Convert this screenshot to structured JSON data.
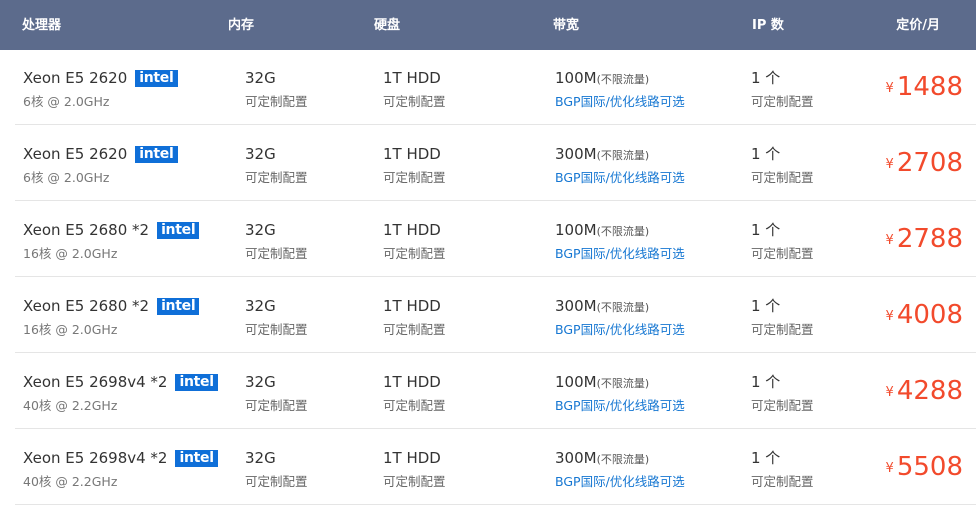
{
  "header": {
    "cpu": "处理器",
    "memory": "内存",
    "disk": "硬盘",
    "bandwidth": "带宽",
    "ip": "IP 数",
    "price": "定价/月"
  },
  "currency_symbol": "¥",
  "brand_badge": "intel",
  "colors": {
    "header_bg": "#5c6b8c",
    "price": "#f24a2c",
    "badge_bg": "#0f6fd8",
    "link_blue": "#1677d2"
  },
  "rows": [
    {
      "cpu_model": "Xeon E5 2620",
      "cpu_spec": "6核 @ 2.0GHz",
      "memory": "32G",
      "memory_note": "可定制配置",
      "disk": "1T HDD",
      "disk_note": "可定制配置",
      "bandwidth": "100M",
      "bandwidth_tag": "(不限流量)",
      "bandwidth_note": "BGP国际/优化线路可选",
      "ip": "1 个",
      "ip_note": "可定制配置",
      "price": "1488"
    },
    {
      "cpu_model": "Xeon E5 2620",
      "cpu_spec": "6核 @ 2.0GHz",
      "memory": "32G",
      "memory_note": "可定制配置",
      "disk": "1T HDD",
      "disk_note": "可定制配置",
      "bandwidth": "300M",
      "bandwidth_tag": "(不限流量)",
      "bandwidth_note": "BGP国际/优化线路可选",
      "ip": "1 个",
      "ip_note": "可定制配置",
      "price": "2708"
    },
    {
      "cpu_model": "Xeon E5 2680 *2",
      "cpu_spec": "16核 @ 2.0GHz",
      "memory": "32G",
      "memory_note": "可定制配置",
      "disk": "1T HDD",
      "disk_note": "可定制配置",
      "bandwidth": "100M",
      "bandwidth_tag": "(不限流量)",
      "bandwidth_note": "BGP国际/优化线路可选",
      "ip": "1 个",
      "ip_note": "可定制配置",
      "price": "2788"
    },
    {
      "cpu_model": "Xeon E5 2680 *2",
      "cpu_spec": "16核 @ 2.0GHz",
      "memory": "32G",
      "memory_note": "可定制配置",
      "disk": "1T HDD",
      "disk_note": "可定制配置",
      "bandwidth": "300M",
      "bandwidth_tag": "(不限流量)",
      "bandwidth_note": "BGP国际/优化线路可选",
      "ip": "1 个",
      "ip_note": "可定制配置",
      "price": "4008"
    },
    {
      "cpu_model": "Xeon E5 2698v4 *2",
      "cpu_spec": "40核 @ 2.2GHz",
      "memory": "32G",
      "memory_note": "可定制配置",
      "disk": "1T HDD",
      "disk_note": "可定制配置",
      "bandwidth": "100M",
      "bandwidth_tag": "(不限流量)",
      "bandwidth_note": "BGP国际/优化线路可选",
      "ip": "1 个",
      "ip_note": "可定制配置",
      "price": "4288"
    },
    {
      "cpu_model": "Xeon E5 2698v4 *2",
      "cpu_spec": "40核 @ 2.2GHz",
      "memory": "32G",
      "memory_note": "可定制配置",
      "disk": "1T HDD",
      "disk_note": "可定制配置",
      "bandwidth": "300M",
      "bandwidth_tag": "(不限流量)",
      "bandwidth_note": "BGP国际/优化线路可选",
      "ip": "1 个",
      "ip_note": "可定制配置",
      "price": "5508"
    }
  ]
}
